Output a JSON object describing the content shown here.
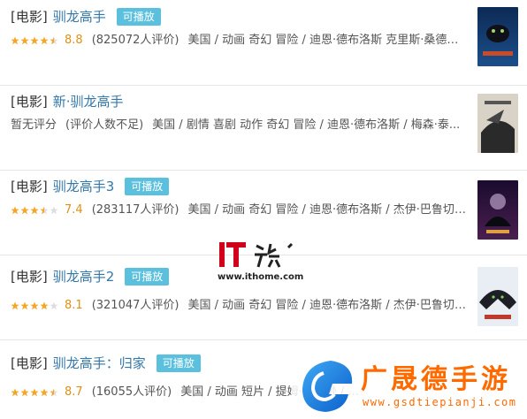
{
  "results": [
    {
      "type": "[电影]",
      "name": "驯龙高手",
      "play_badge": "可播放",
      "rating": 4.5,
      "score": "8.8",
      "count": "(825072人评价)",
      "meta": "美国 / 动画 奇幻 冒险 / 迪恩·德布洛斯 克里斯·桑德斯 / ..."
    },
    {
      "type": "[电影]",
      "name": "新·驯龙高手",
      "play_badge": "",
      "no_score": "暂无评分",
      "count": "(评价人数不足)",
      "meta": "美国 / 剧情 喜剧 动作 奇幻 冒险 / 迪恩·德布洛斯 / 梅森·泰..."
    },
    {
      "type": "[电影]",
      "name": "驯龙高手3",
      "play_badge": "可播放",
      "rating": 3.5,
      "score": "7.4",
      "count": "(283117人评价)",
      "meta": "美国 / 动画 奇幻 冒险 / 迪恩·德布洛斯 / 杰伊·巴鲁切尔 / ..."
    },
    {
      "type": "[电影]",
      "name": "驯龙高手2",
      "play_badge": "可播放",
      "rating": 4.0,
      "score": "8.1",
      "count": "(321047人评价)",
      "meta": "美国 / 动画 奇幻 冒险 / 迪恩·德布洛斯 / 杰伊·巴鲁切尔 / ..."
    },
    {
      "type": "[电影]",
      "name": "驯龙高手：归家",
      "play_badge": "可播放",
      "rating": 4.5,
      "score": "8.7",
      "count": "(16055人评价)",
      "meta": "美国 / 动画 短片 / 提姆·约翰逊 / ..."
    }
  ],
  "watermark_ithome": {
    "logo_text": "IT之家",
    "url": "www.ithome.com"
  },
  "watermark_gsd": {
    "name": "广晟德手游",
    "domain": "www.gsdtiepianji.com"
  },
  "colors": {
    "link": "#3377aa",
    "badge": "#5bc0de",
    "star": "#f5a623",
    "score": "#e09015"
  }
}
